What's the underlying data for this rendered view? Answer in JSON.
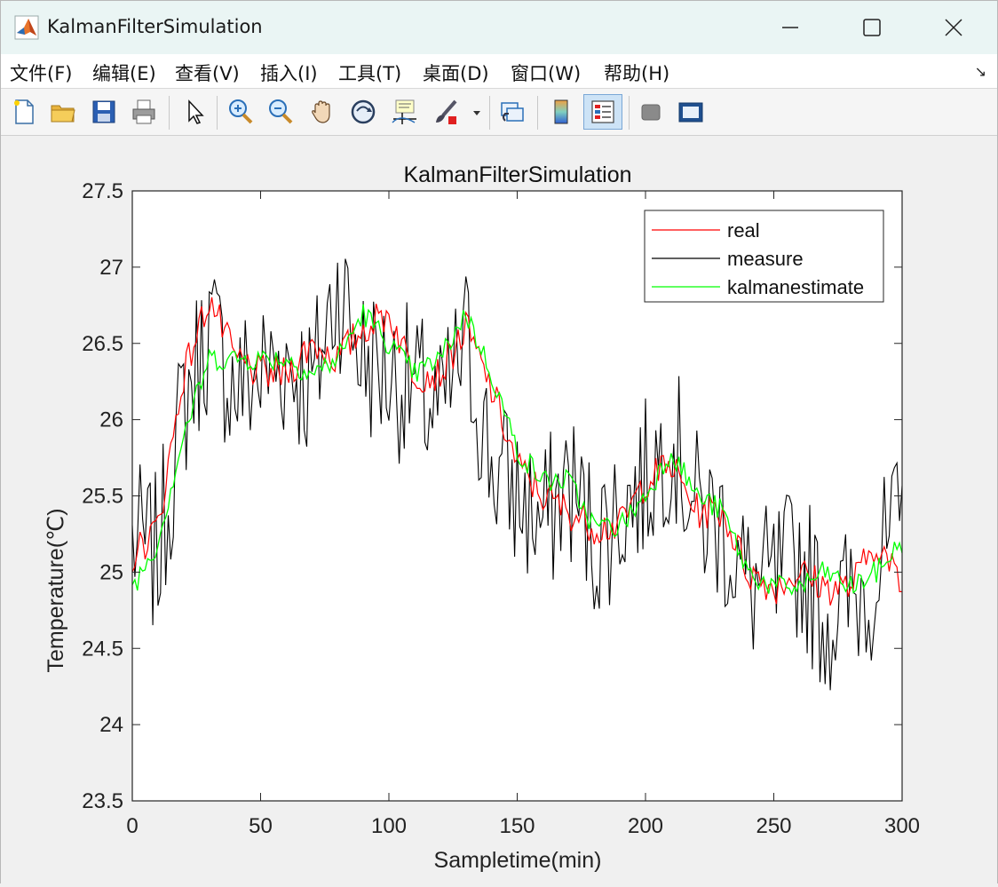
{
  "window": {
    "title": "KalmanFilterSimulation",
    "icon": "matlab-icon"
  },
  "menu": [
    {
      "name": "menu-file",
      "label": "文件(F)"
    },
    {
      "name": "menu-edit",
      "label": "编辑(E)"
    },
    {
      "name": "menu-view",
      "label": "查看(V)"
    },
    {
      "name": "menu-insert",
      "label": "插入(I)"
    },
    {
      "name": "menu-tools",
      "label": "工具(T)"
    },
    {
      "name": "menu-desktop",
      "label": "桌面(D)"
    },
    {
      "name": "menu-window",
      "label": "窗口(W)"
    },
    {
      "name": "menu-help",
      "label": "帮助(H)"
    }
  ],
  "toolbar": {
    "icons": [
      "new-file-icon",
      "open-folder-icon",
      "save-icon",
      "print-icon",
      "pointer-icon",
      "zoom-in-icon",
      "zoom-out-icon",
      "pan-hand-icon",
      "rotate-3d-icon",
      "data-cursor-icon",
      "brush-icon",
      "link-plot-icon",
      "colorbar-icon",
      "legend-icon",
      "hide-plot-tools-icon",
      "show-plot-tools-icon"
    ],
    "active": "legend-icon"
  },
  "chart_data": {
    "type": "line",
    "title": "KalmanFilterSimulation",
    "xlabel": "Sampletime(min)",
    "ylabel": "Temperature(℃)",
    "xlim": [
      0,
      300
    ],
    "ylim": [
      23.5,
      27.5
    ],
    "xticks": [
      "0",
      "50",
      "100",
      "150",
      "200",
      "250",
      "300"
    ],
    "yticks": [
      "23.5",
      "24",
      "24.5",
      "25",
      "25.5",
      "26",
      "26.5",
      "27",
      "27.5"
    ],
    "legend_position": "top-right",
    "grid": false,
    "series": [
      {
        "name": "real",
        "color": "#ff0000",
        "x": [
          0,
          10,
          20,
          30,
          40,
          50,
          60,
          70,
          80,
          90,
          100,
          110,
          120,
          130,
          140,
          150,
          160,
          170,
          180,
          190,
          200,
          210,
          220,
          230,
          240,
          250,
          260,
          270,
          280,
          290,
          300
        ],
        "y": [
          25.1,
          25.3,
          26.3,
          26.8,
          26.4,
          26.3,
          26.3,
          26.5,
          26.4,
          26.6,
          26.7,
          26.3,
          26.3,
          26.6,
          26.2,
          25.7,
          25.5,
          25.4,
          25.3,
          25.3,
          25.6,
          25.7,
          25.4,
          25.4,
          25.0,
          24.9,
          25.0,
          24.9,
          24.9,
          25.2,
          24.9
        ]
      },
      {
        "name": "measure",
        "color": "#000000",
        "x": [
          0,
          10,
          20,
          30,
          40,
          50,
          60,
          70,
          80,
          90,
          100,
          110,
          120,
          130,
          140,
          150,
          160,
          170,
          180,
          190,
          200,
          210,
          220,
          230,
          240,
          250,
          260,
          270,
          280,
          290,
          300
        ],
        "y": [
          25.2,
          25.1,
          26.1,
          26.6,
          26.2,
          26.3,
          26.4,
          26.2,
          26.9,
          26.4,
          26.3,
          26.2,
          26.0,
          26.5,
          25.7,
          25.5,
          25.3,
          25.6,
          25.2,
          25.4,
          25.6,
          25.9,
          25.4,
          25.3,
          24.9,
          24.9,
          25.1,
          24.7,
          24.8,
          25.0,
          25.3
        ]
      },
      {
        "name": "kalmanestimate",
        "color": "#00ff00",
        "x": [
          0,
          10,
          20,
          30,
          40,
          50,
          60,
          70,
          80,
          90,
          100,
          110,
          120,
          130,
          140,
          150,
          160,
          170,
          180,
          190,
          200,
          210,
          220,
          230,
          240,
          250,
          260,
          270,
          280,
          290,
          300
        ],
        "y": [
          24.9,
          25.2,
          25.9,
          26.4,
          26.4,
          26.4,
          26.4,
          26.3,
          26.4,
          26.7,
          26.5,
          26.3,
          26.4,
          26.7,
          26.3,
          25.8,
          25.6,
          25.6,
          25.3,
          25.3,
          25.5,
          25.8,
          25.5,
          25.4,
          25.0,
          24.9,
          24.9,
          25.0,
          24.9,
          25.0,
          25.2
        ]
      }
    ]
  }
}
